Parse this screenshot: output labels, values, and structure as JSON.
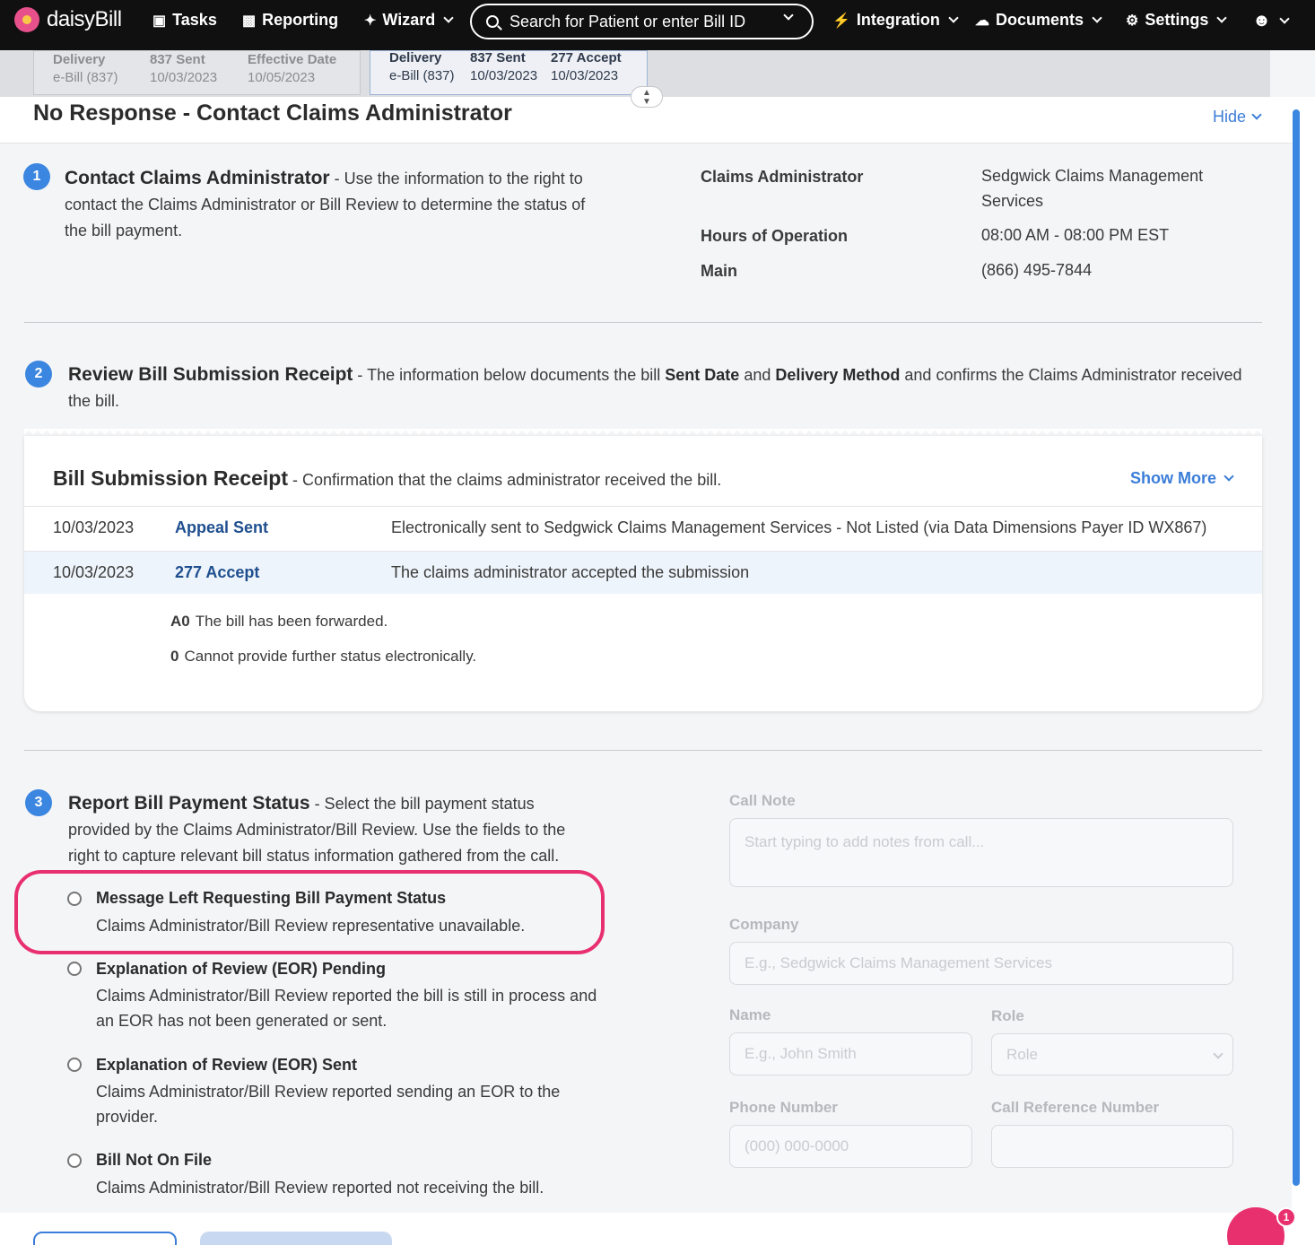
{
  "nav": {
    "brand": "daisyBill",
    "tasks": "Tasks",
    "reporting": "Reporting",
    "wizard": "Wizard",
    "search_placeholder": "Search for Patient or enter Bill ID",
    "integration": "Integration",
    "documents": "Documents",
    "settings": "Settings"
  },
  "tracker": [
    {
      "label1": "Delivery",
      "value1": "e-Bill (837)",
      "label2": "837 Sent",
      "value2": "10/03/2023",
      "label3": "Effective Date",
      "value3": "10/05/2023"
    },
    {
      "label1": "Delivery",
      "value1": "e-Bill (837)",
      "label2": "837 Sent",
      "value2": "10/03/2023",
      "label3": "277 Accept",
      "value3": "10/03/2023"
    }
  ],
  "panel": {
    "title": "No Response - Contact Claims Administrator",
    "hide_label": "Hide"
  },
  "step1": {
    "num": "1",
    "heading": "Contact Claims Administrator",
    "text": " - Use the information to the right to contact the Claims Administrator or Bill Review to determine the status of the bill payment.",
    "details": [
      {
        "label": "Claims Administrator",
        "value": "Sedgwick Claims Management Services"
      },
      {
        "label": "Hours of Operation",
        "value": "08:00 AM - 08:00 PM EST"
      },
      {
        "label": "Main",
        "value": "(866) 495-7844"
      }
    ]
  },
  "step2": {
    "num": "2",
    "heading": "Review Bill Submission Receipt",
    "text_a": " - The information below documents the bill ",
    "bold_a": "Sent Date",
    "text_b": " and ",
    "bold_b": "Delivery Method",
    "text_c": " and confirms the Claims Administrator received the bill."
  },
  "receipt": {
    "title": "Bill Submission Receipt",
    "subtitle": " - Confirmation that the claims administrator received the bill.",
    "show_more": "Show More",
    "rows": [
      {
        "date": "10/03/2023",
        "type": "Appeal Sent",
        "desc": "Electronically sent to Sedgwick Claims Management Services - Not Listed (via Data Dimensions Payer ID WX867)"
      },
      {
        "date": "10/03/2023",
        "type": "277 Accept",
        "desc": "The claims administrator accepted the submission"
      }
    ],
    "codes": [
      {
        "code": "A0",
        "text": "The bill has been forwarded."
      },
      {
        "code": "0",
        "text": "Cannot provide further status electronically."
      }
    ]
  },
  "step3": {
    "num": "3",
    "heading": "Report Bill Payment Status",
    "text": " - Select the bill payment status provided by the Claims Administrator/Bill Review. Use the fields to the right to capture relevant bill status information gathered from the call.",
    "options": [
      {
        "title": "Message Left Requesting Bill Payment Status",
        "desc": "Claims Administrator/Bill Review representative unavailable."
      },
      {
        "title": "Explanation of Review (EOR) Pending",
        "desc": "Claims Administrator/Bill Review reported the bill is still in process and an EOR has not been generated or sent."
      },
      {
        "title": "Explanation of Review (EOR) Sent",
        "desc": "Claims Administrator/Bill Review reported sending an EOR to the provider."
      },
      {
        "title": "Bill Not On File",
        "desc": "Claims Administrator/Bill Review reported not receiving the bill."
      }
    ]
  },
  "form": {
    "call_note_label": "Call Note",
    "call_note_placeholder": "Start typing to add notes from call...",
    "company_label": "Company",
    "company_placeholder": "E.g., Sedgwick Claims Management Services",
    "name_label": "Name",
    "name_placeholder": "E.g., John Smith",
    "role_label": "Role",
    "role_value": "Role",
    "phone_label": "Phone Number",
    "phone_placeholder": "(000) 000-0000",
    "ref_label": "Call Reference Number",
    "ref_placeholder": ""
  },
  "chat": {
    "badge": "1"
  },
  "colors": {
    "accent": "#3b86e0",
    "highlight": "#e8306e",
    "nav_bg": "#101010"
  }
}
